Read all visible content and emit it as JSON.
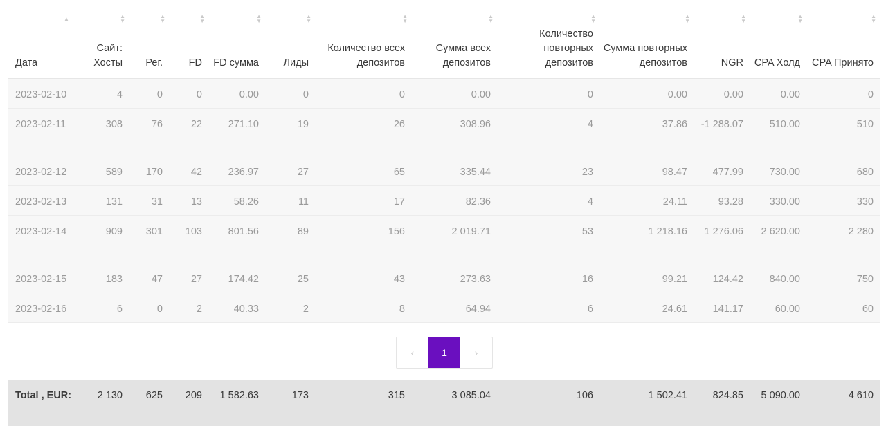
{
  "table": {
    "columns": [
      {
        "label": "Дата"
      },
      {
        "label": "Сайт: Хосты"
      },
      {
        "label": "Рег."
      },
      {
        "label": "FD"
      },
      {
        "label": "FD сумма"
      },
      {
        "label": "Лиды"
      },
      {
        "label": "Количество всех депозитов"
      },
      {
        "label": "Сумма всех депозитов"
      },
      {
        "label": "Количество повторных депозитов"
      },
      {
        "label": "Сумма повторных депозитов"
      },
      {
        "label": "NGR"
      },
      {
        "label": "CPA Холд"
      },
      {
        "label": "CPA Принято"
      }
    ],
    "rows": [
      [
        "2023-02-10",
        "4",
        "0",
        "0",
        "0.00",
        "0",
        "0",
        "0.00",
        "0",
        "0.00",
        "0.00",
        "0.00",
        "0"
      ],
      [
        "2023-02-11",
        "308",
        "76",
        "22",
        "271.10",
        "19",
        "26",
        "308.96",
        "4",
        "37.86",
        "-1 288.07",
        "510.00",
        "510"
      ],
      [
        "2023-02-12",
        "589",
        "170",
        "42",
        "236.97",
        "27",
        "65",
        "335.44",
        "23",
        "98.47",
        "477.99",
        "730.00",
        "680"
      ],
      [
        "2023-02-13",
        "131",
        "31",
        "13",
        "58.26",
        "11",
        "17",
        "82.36",
        "4",
        "24.11",
        "93.28",
        "330.00",
        "330"
      ],
      [
        "2023-02-14",
        "909",
        "301",
        "103",
        "801.56",
        "89",
        "156",
        "2 019.71",
        "53",
        "1 218.16",
        "1 276.06",
        "2 620.00",
        "2 280"
      ],
      [
        "2023-02-15",
        "183",
        "47",
        "27",
        "174.42",
        "25",
        "43",
        "273.63",
        "16",
        "99.21",
        "124.42",
        "840.00",
        "750"
      ],
      [
        "2023-02-16",
        "6",
        "0",
        "2",
        "40.33",
        "2",
        "8",
        "64.94",
        "6",
        "24.61",
        "141.17",
        "60.00",
        "60"
      ]
    ],
    "total": [
      "Total , EUR:",
      "2 130",
      "625",
      "209",
      "1 582.63",
      "173",
      "315",
      "3 085.04",
      "106",
      "1 502.41",
      "824.85",
      "5 090.00",
      "4 610"
    ]
  },
  "pagination": {
    "prev": "‹",
    "current": "1",
    "next": "›"
  }
}
